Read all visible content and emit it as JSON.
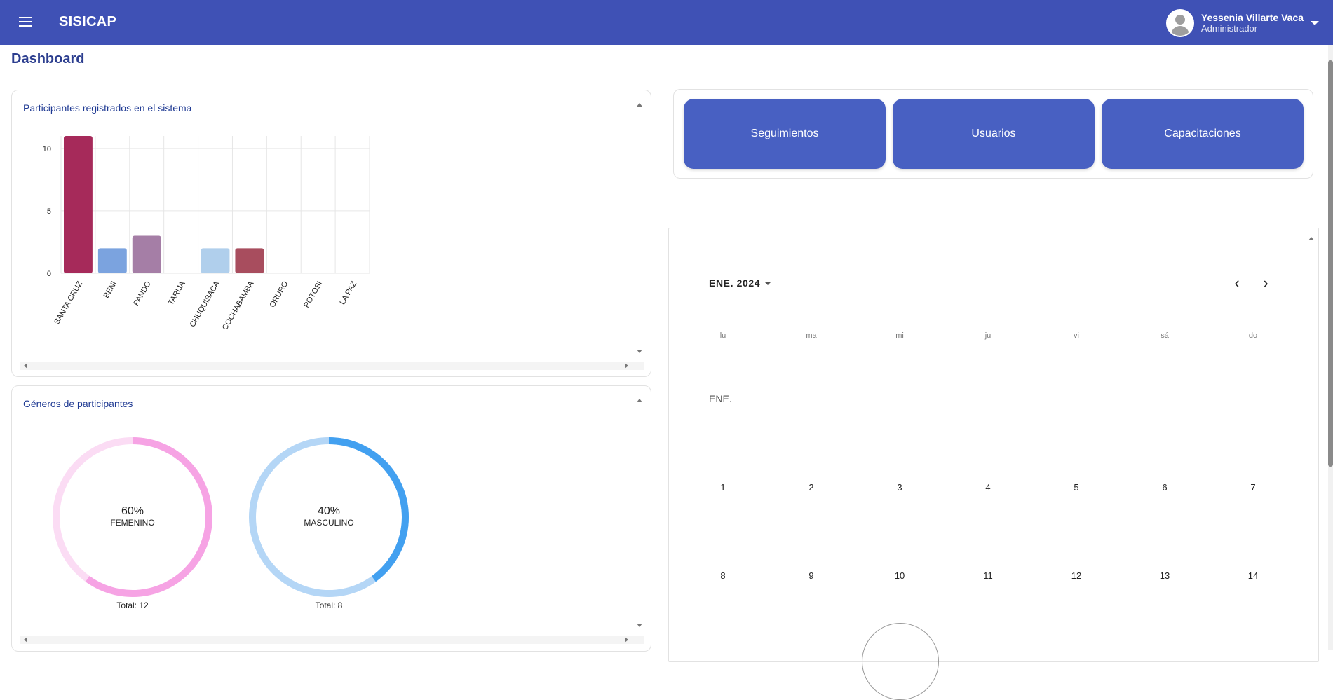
{
  "header": {
    "app_title": "SISICAP",
    "user_name": "Yessenia Villarte Vaca",
    "user_role": "Administrador",
    "bar_color": "#3f51b5"
  },
  "page": {
    "title": "Dashboard"
  },
  "participants_card": {
    "title": "Participantes registrados en el sistema"
  },
  "chart_data": [
    {
      "type": "bar",
      "title": "",
      "xlabel": "",
      "ylabel": "",
      "categories": [
        "SANTA CRUZ",
        "BENI",
        "PANDO",
        "TARIJA",
        "CHUQUISACA",
        "COCHABAMBA",
        "ORURO",
        "POTOSI",
        "LA PAZ"
      ],
      "values": [
        11,
        2,
        3,
        0,
        2,
        2,
        0,
        0,
        0
      ],
      "colors": [
        "#a62a5a",
        "#7ba3df",
        "#a57ea6",
        "#cccccc",
        "#b0cfec",
        "#a84d5e",
        "#cccccc",
        "#cccccc",
        "#cccccc"
      ],
      "yticks": [
        "0",
        "5",
        "10"
      ],
      "ylim": [
        0,
        11
      ],
      "grid": true
    },
    {
      "type": "pie",
      "title": "Géneros de participantes",
      "slices": [
        {
          "label": "FEMENINO",
          "percent": "60%",
          "total_label": "Total: 12",
          "color": "#f6a3e4",
          "track_color": "#fbdcf4",
          "fraction": 0.6
        },
        {
          "label": "MASCULINO",
          "percent": "40%",
          "total_label": "Total: 8",
          "color": "#42a0f0",
          "track_color": "#b4d6f6",
          "fraction": 0.4
        }
      ]
    }
  ],
  "genders_card": {
    "title": "Géneros de participantes"
  },
  "actions": {
    "seguimientos": "Seguimientos",
    "usuarios": "Usuarios",
    "capacitaciones": "Capacitaciones",
    "button_color": "#4860c2"
  },
  "calendar": {
    "month_year": "ENE. 2024",
    "month_short": "ENE.",
    "weekdays": [
      "lu",
      "ma",
      "mi",
      "ju",
      "vi",
      "sá",
      "do"
    ],
    "week1": [
      "1",
      "2",
      "3",
      "4",
      "5",
      "6",
      "7"
    ],
    "week2": [
      "8",
      "9",
      "10",
      "11",
      "12",
      "13",
      "14"
    ]
  }
}
